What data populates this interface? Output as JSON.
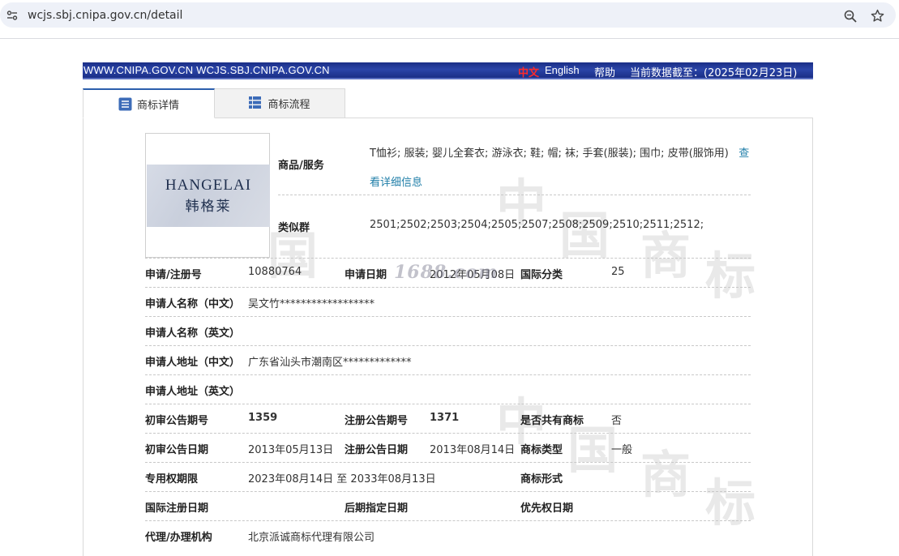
{
  "browser": {
    "url": "wcjs.sbj.cnipa.gov.cn/detail"
  },
  "banner": {
    "sites": "WWW.CNIPA.GOV.CN WCJS.SBJ.CNIPA.GOV.CN",
    "lang_cn": "中文",
    "lang_en": "English",
    "help": "帮助",
    "data_date": "当前数据截至：(2025年02月23日)"
  },
  "tabs": [
    {
      "label": "商标详情",
      "icon": "list-icon",
      "active": true
    },
    {
      "label": "商标流程",
      "icon": "table-icon",
      "active": false
    }
  ],
  "logo": {
    "text_en": "HANGELAI",
    "text_cn": "韩格莱"
  },
  "watermark": {
    "chars": [
      "中",
      "国",
      "商",
      "标"
    ]
  },
  "stamp": "1688.com",
  "detail": {
    "goods_label": "商品/服务",
    "goods_value": "T恤衫; 服装; 婴儿全套衣; 游泳衣; 鞋; 帽; 袜; 手套(服装); 围巾; 皮带(服饰用)",
    "goods_more": "查看详细信息",
    "similar_label": "类似群",
    "similar_value": "2501;2502;2503;2504;2505;2507;2508;2509;2510;2511;2512;",
    "reg_no_label": "申请/注册号",
    "reg_no": "10880764",
    "apply_date_label": "申请日期",
    "apply_date": "2012年05月08日",
    "intl_class_label": "国际分类",
    "intl_class": "25",
    "applicant_cn_label": "申请人名称（中文）",
    "applicant_cn": "吴文竹******************",
    "applicant_en_label": "申请人名称（英文）",
    "applicant_en": "",
    "address_cn_label": "申请人地址（中文）",
    "address_cn": "广东省汕头市潮南区*************",
    "address_en_label": "申请人地址（英文）",
    "address_en": "",
    "prelim_no_label": "初审公告期号",
    "prelim_no": "1359",
    "reg_pub_no_label": "注册公告期号",
    "reg_pub_no": "1371",
    "shared_label": "是否共有商标",
    "shared": "否",
    "prelim_date_label": "初审公告日期",
    "prelim_date": "2013年05月13日",
    "reg_pub_date_label": "注册公告日期",
    "reg_pub_date": "2013年08月14日",
    "mark_type_label": "商标类型",
    "mark_type": "一般",
    "exclusive_label": "专用权期限",
    "exclusive": "2023年08月14日 至 2033年08月13日",
    "mark_form_label": "商标形式",
    "mark_form": "",
    "intl_reg_date_label": "国际注册日期",
    "later_date_label": "后期指定日期",
    "priority_date_label": "优先权日期",
    "agent_label": "代理/办理机构",
    "agent": "北京派诚商标代理有限公司"
  }
}
